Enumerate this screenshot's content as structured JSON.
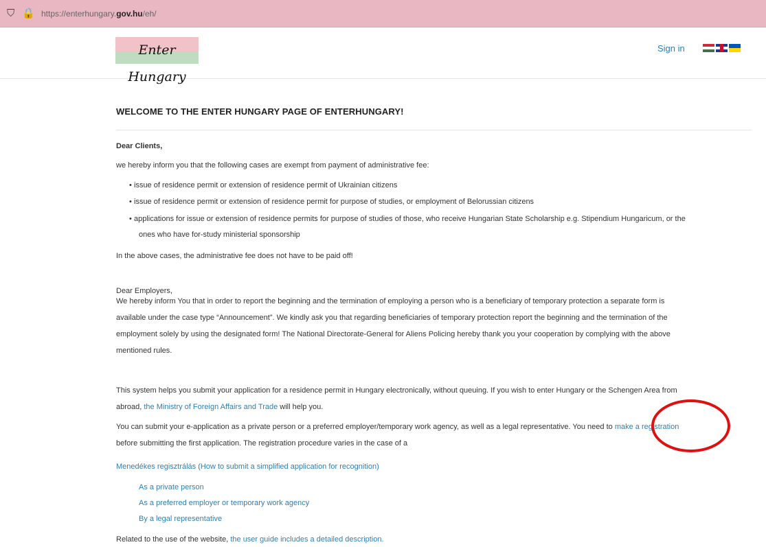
{
  "browser": {
    "url_prefix": "https://enterhungary.",
    "url_domain": "gov.hu",
    "url_suffix": "/eh/"
  },
  "header": {
    "logo_text": "Enter Hungary",
    "signin_label": "Sign in"
  },
  "main": {
    "title": "WELCOME TO THE ENTER HUNGARY PAGE OF ENTERHUNGARY!",
    "dear_clients": "Dear Clients,",
    "inform": "we hereby inform you that the following cases are exempt from payment of administrative fee:",
    "bullets": [
      "issue of residence permit or extension of residence permit of Ukrainian citizens",
      "issue of residence permit or extension of residence permit for purpose of studies, or employment of Belorussian citizens",
      "applications for issue or extension of residence permits for purpose of studies of those, who receive Hungarian State Scholarship e.g. Stipendium Hungaricum, or the",
      "ones who have for-study ministerial sponsorship"
    ],
    "paid_off": "In the above cases, the administrative fee does not have to be paid off!",
    "dear_employers": "Dear Employers,",
    "employers_lines": [
      "We hereby inform You that in order to report the beginning and the termination of employing a person who is a beneficiary of temporary protection a separate form is",
      "available under the case type “Announcement”. We kindly ask you that regarding beneficiaries of temporary protection report the beginning and the termination of the",
      "employment solely by using the designated form! The National Directorate-General for Aliens Policing hereby thank you your cooperation by complying with the above",
      "mentioned rules."
    ],
    "system_line1": "This system helps you submit your application for a residence permit in Hungary electronically, without queuing. If you wish to enter Hungary or the Schengen Area from",
    "system_line2_pre": "abroad,",
    "ministry_link": "the Ministry of Foreign Affairs and Trade",
    "system_line2_post": "will help you.",
    "submit_line1": "You can submit your e-application as a private person or a preferred employer/temporary work agency, as well as a legal representative. You need to",
    "registration_link": "make a registration",
    "submit_line2": "before submitting the first application. The registration procedure varies in the case of a",
    "menedekes_link": "Menedékes regisztrálás (How to submit a simplified application for recognition)",
    "reg_options": [
      "As a private person",
      "As a preferred employer or temporary work agency",
      "By a legal representative"
    ],
    "related_pre": "Related to the use of the website,",
    "user_guide_link": "the user guide includes a detailed description."
  },
  "colors": {
    "urlbar": "#e8b7c2",
    "link": "#2d7fb4",
    "annotation_circle": "#e01010"
  }
}
